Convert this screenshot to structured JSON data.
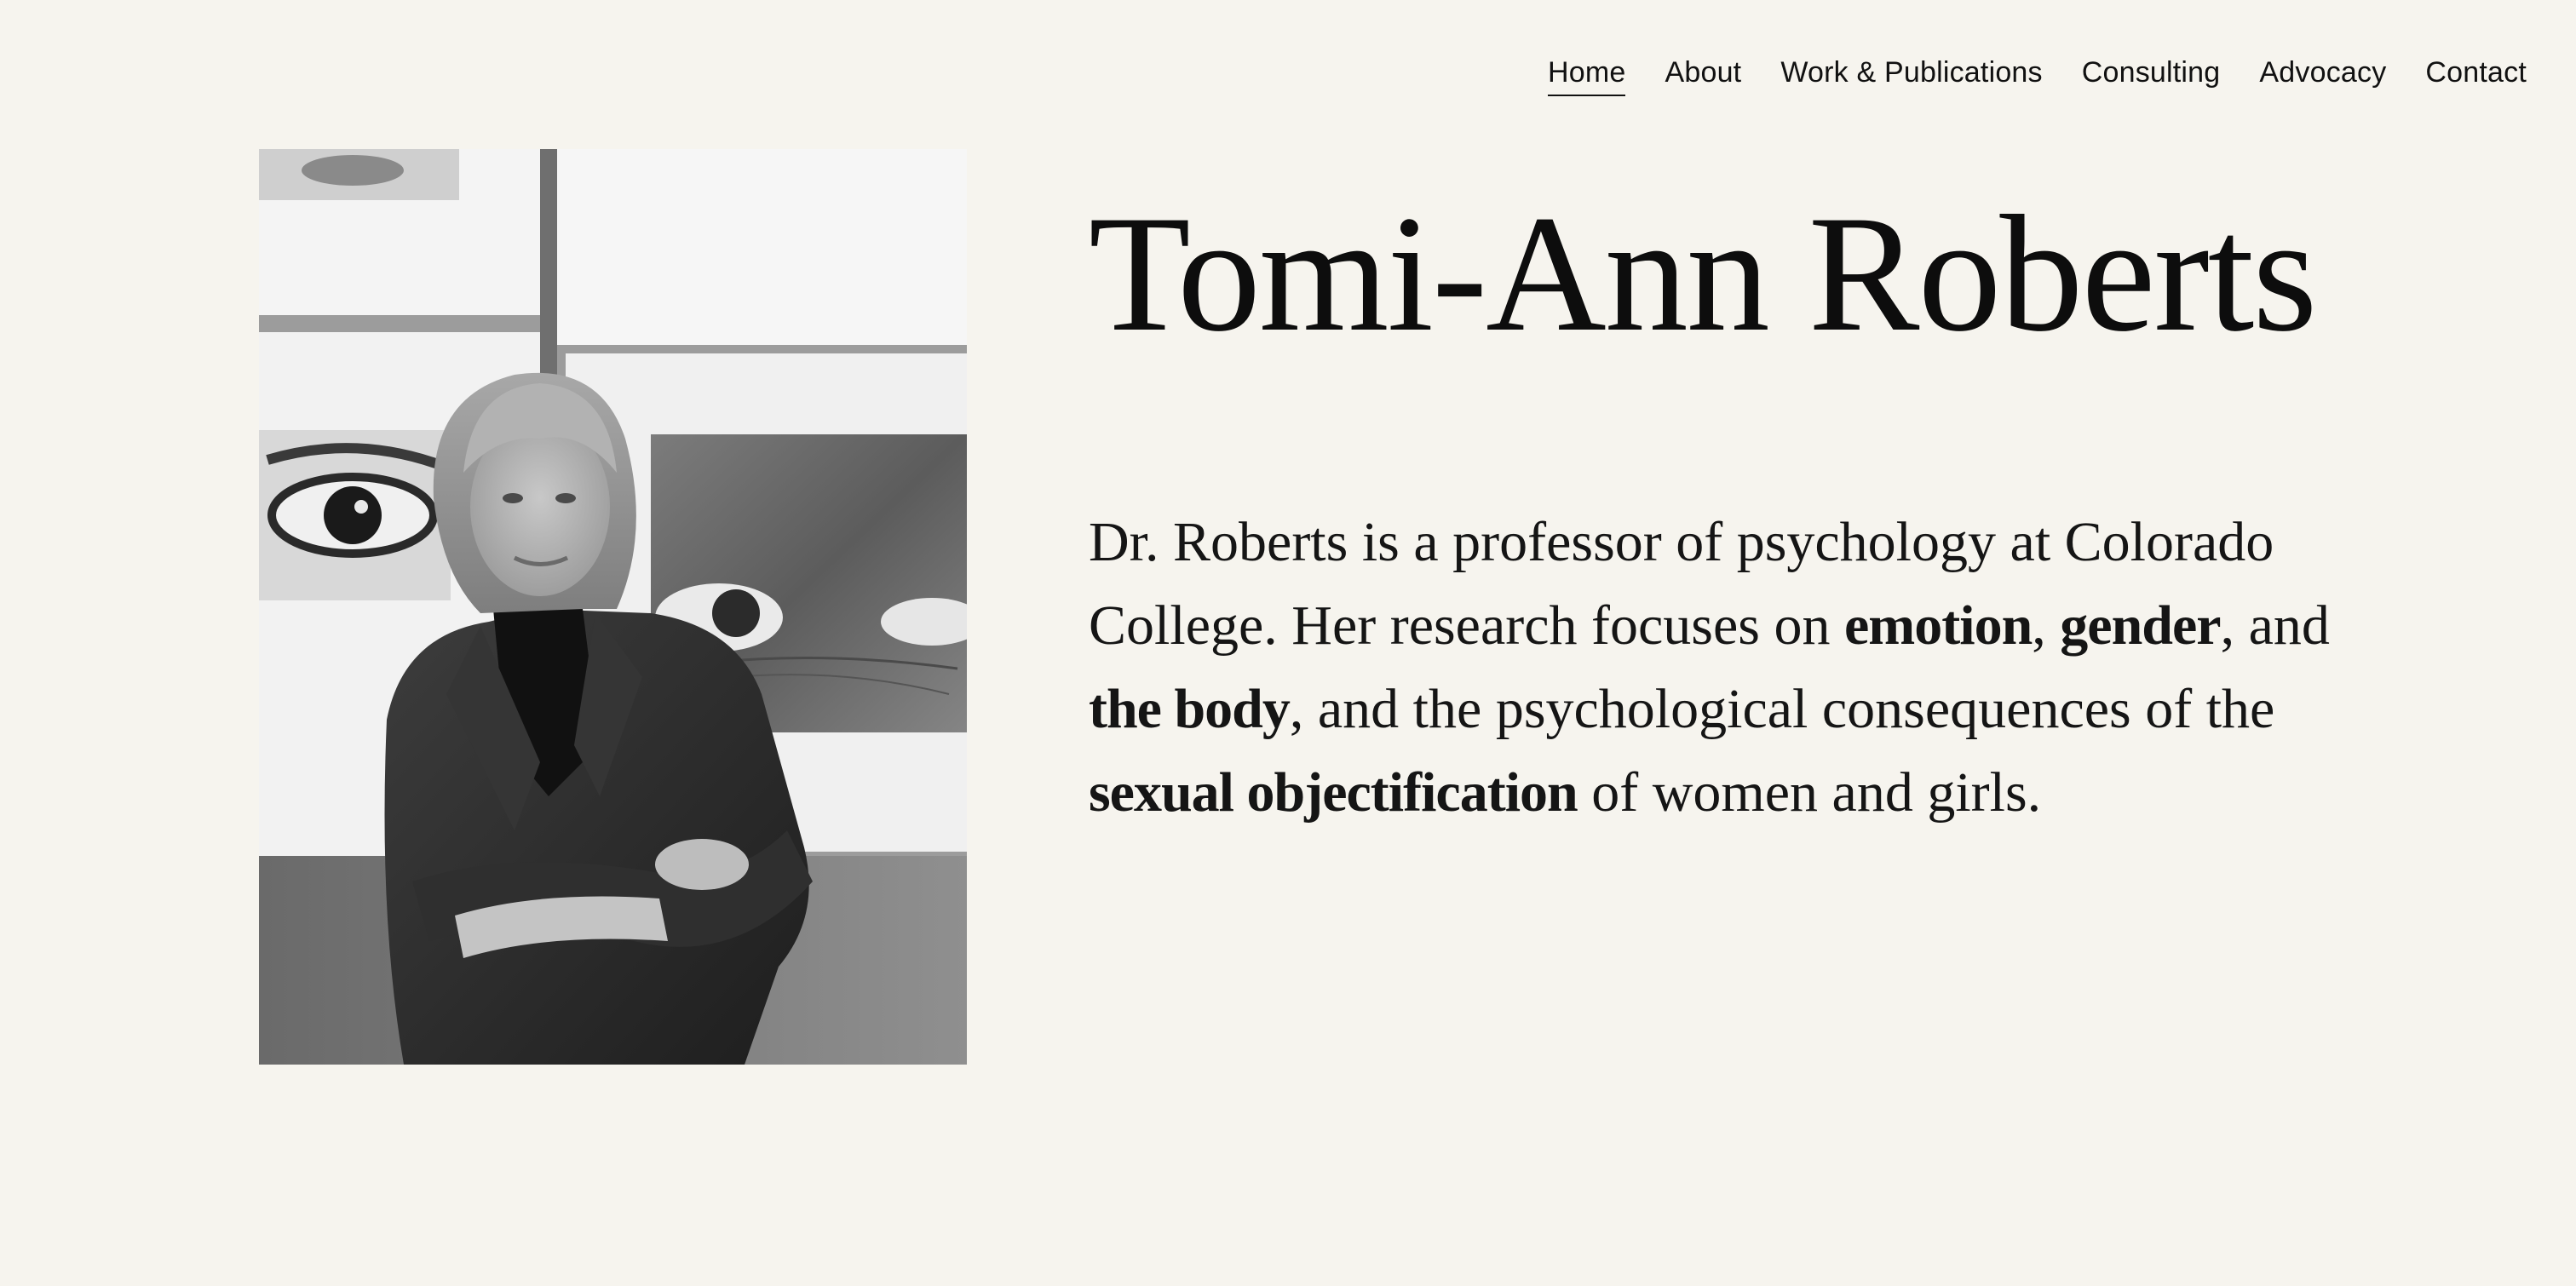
{
  "nav": {
    "items": [
      {
        "label": "Home",
        "active": true
      },
      {
        "label": "About"
      },
      {
        "label": "Work & Publications"
      },
      {
        "label": "Consulting"
      },
      {
        "label": "Advocacy"
      },
      {
        "label": "Contact"
      }
    ]
  },
  "hero": {
    "title": "Tomi-Ann Roberts",
    "bio": {
      "part1": "Dr. Roberts is a professor of psychology at Colorado College. Her research focuses on ",
      "kw1": "emotion",
      "sep1": ", ",
      "kw2": "gender",
      "sep2": ", and ",
      "kw3": "the body",
      "part2": ", and the psychological consequences of the ",
      "kw4": "sexual objectification",
      "part3": " of women and girls."
    }
  },
  "image": {
    "alt_semantic": "portrait-photo"
  }
}
